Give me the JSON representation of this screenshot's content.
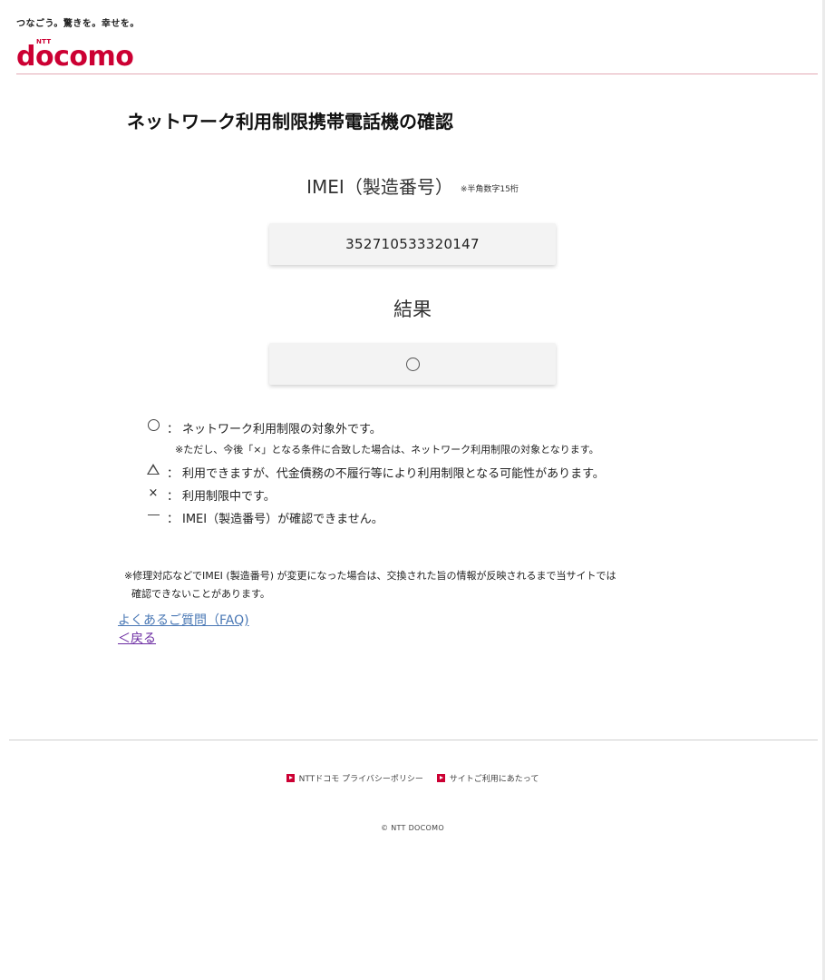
{
  "header": {
    "tagline": "つなごう。驚きを。幸せを。",
    "logo_ntt": "NTT",
    "logo_word": "docomo",
    "brand_color": "#cc0033"
  },
  "page": {
    "title": "ネットワーク利用制限携帯電話機の確認"
  },
  "imei": {
    "label": "IMEI（製造番号）",
    "note": "※半角数字15桁",
    "value": "352710533320147"
  },
  "result": {
    "label": "結果",
    "mark": "○"
  },
  "legend": {
    "colon": "：",
    "items": [
      {
        "symbol": "circle-icon",
        "text": "ネットワーク利用制限の対象外です。"
      },
      {
        "symbol": "triangle-icon",
        "text": "利用できますが、代金債務の不履行等により利用制限となる可能性があります。"
      },
      {
        "symbol": "cross",
        "glyph": "×",
        "text": "利用制限中です。"
      },
      {
        "symbol": "dash-icon",
        "text": "IMEI（製造番号）が確認できません。"
      }
    ],
    "sub_note": "※ただし、今後「×」となる条件に合致した場合は、ネットワーク利用制限の対象となります。"
  },
  "footnote": {
    "line1": "※修理対応などでIMEI (製造番号) が変更になった場合は、交換された旨の情報が反映されるまで当サイトでは",
    "line2": "確認できないことがあります。"
  },
  "links": {
    "faq": "よくあるご質問（FAQ)",
    "back": "＜戻る"
  },
  "footer": {
    "privacy": "NTTドコモ プライバシーポリシー",
    "terms": "サイトご利用にあたって",
    "copyright": "© NTT DOCOMO"
  }
}
